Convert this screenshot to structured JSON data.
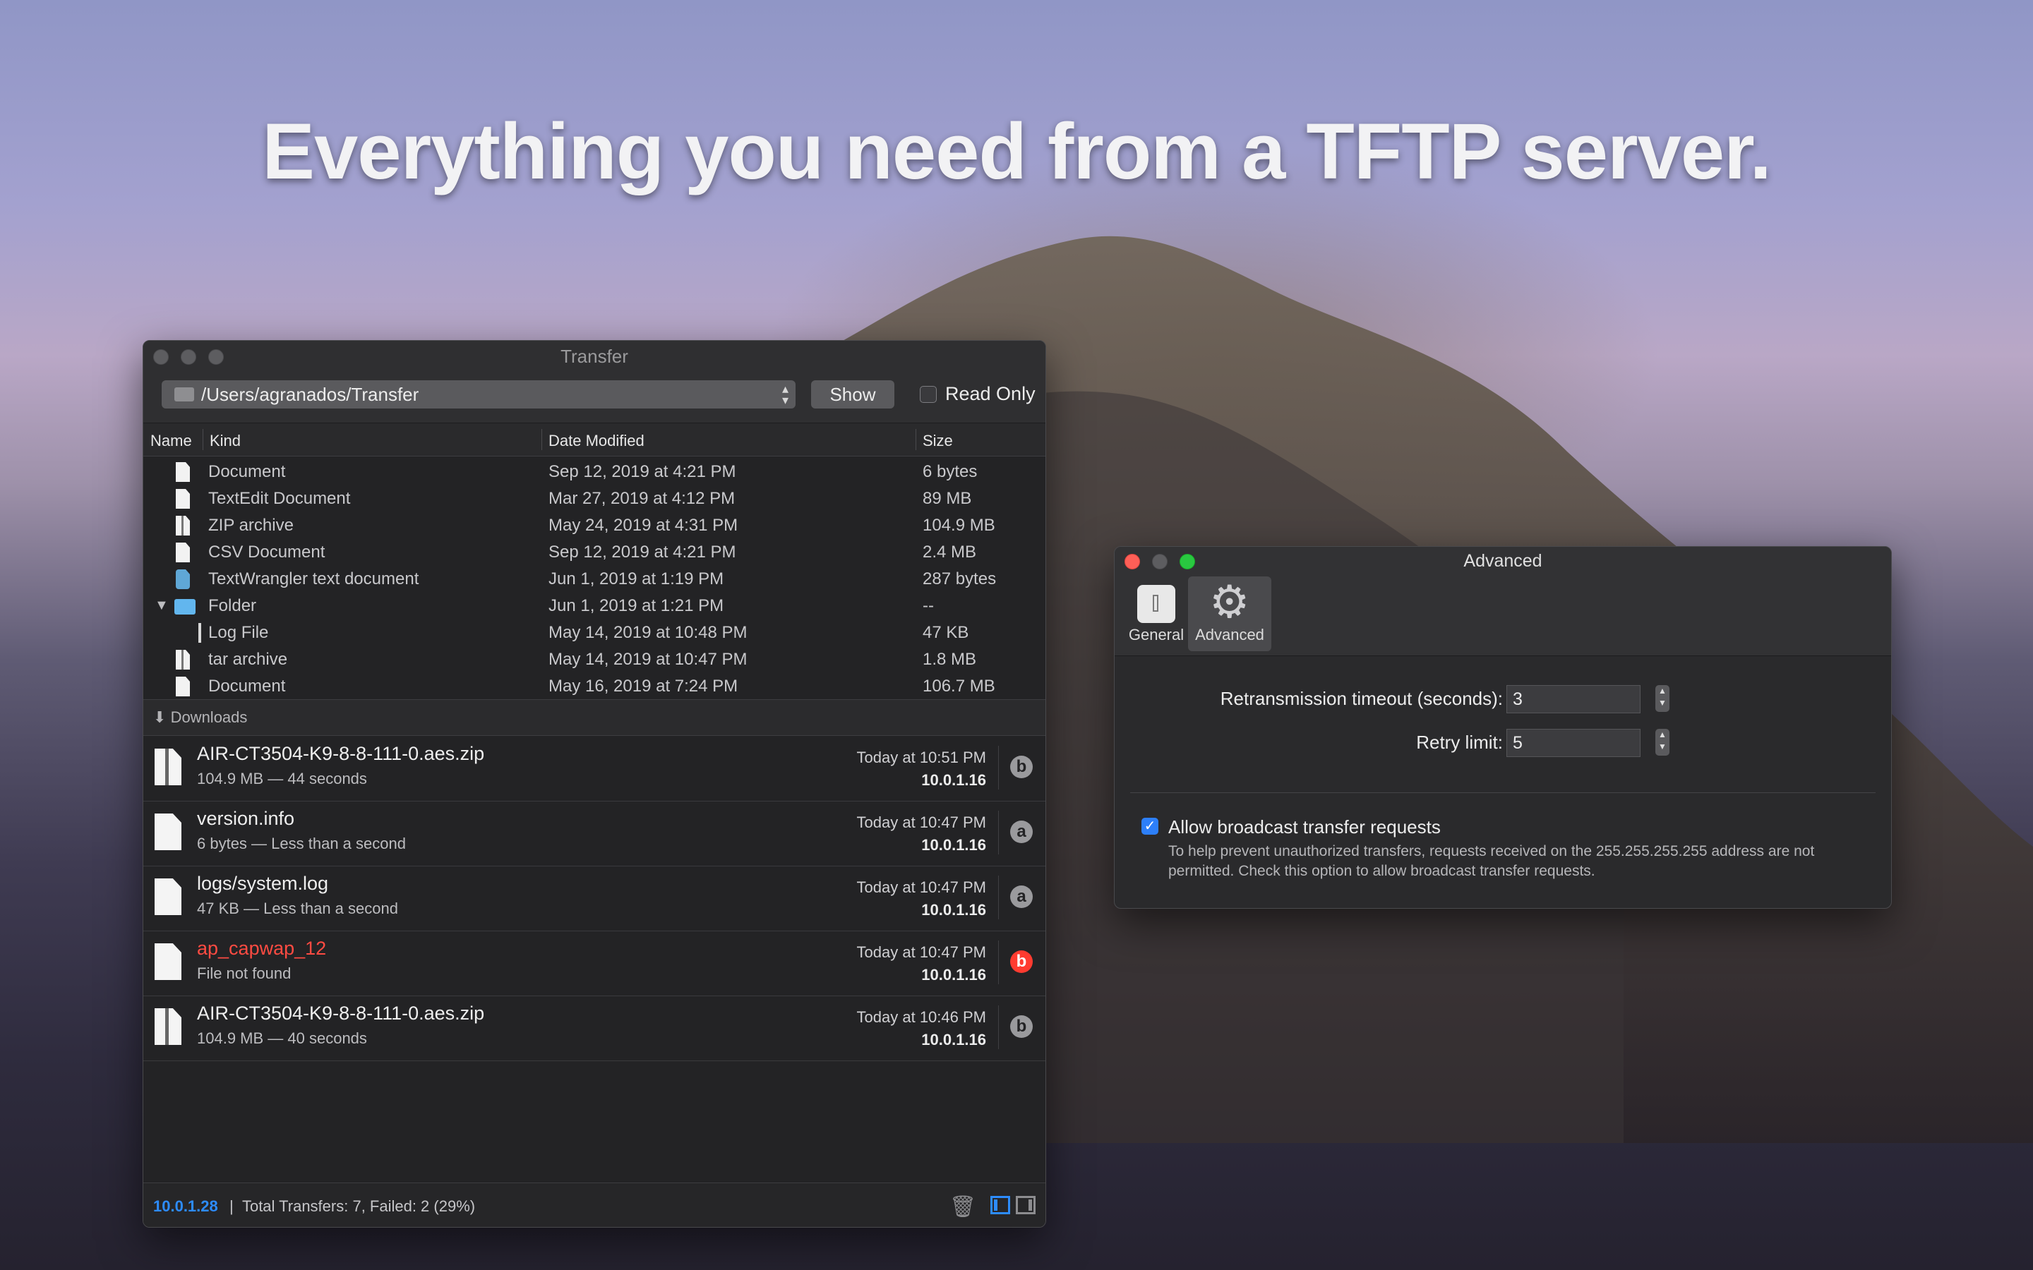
{
  "hero": {
    "headline": "Everything you need from a TFTP server."
  },
  "transfer_window": {
    "title": "Transfer",
    "path": "/Users/agranados/Transfer",
    "show_label": "Show",
    "read_only_label": "Read Only",
    "columns": {
      "name": "Name",
      "kind": "Kind",
      "date": "Date Modified",
      "size": "Size"
    },
    "files": [
      {
        "kind": "Document",
        "date": "Sep 12, 2019 at 4:21 PM",
        "size": "6 bytes",
        "icon": "document-icon"
      },
      {
        "kind": "TextEdit Document",
        "date": "Mar 27, 2019 at 4:12 PM",
        "size": "89 MB",
        "icon": "document-icon"
      },
      {
        "kind": "ZIP archive",
        "date": "May 24, 2019 at 4:31 PM",
        "size": "104.9 MB",
        "icon": "zip-file-icon"
      },
      {
        "kind": "CSV Document",
        "date": "Sep 12, 2019 at 4:21 PM",
        "size": "2.4 MB",
        "icon": "document-icon"
      },
      {
        "kind": "TextWrangler text document",
        "date": "Jun 1, 2019 at 1:19 PM",
        "size": "287 bytes",
        "icon": "textwrangler-icon"
      },
      {
        "kind": "Folder",
        "date": "Jun 1, 2019 at 1:21 PM",
        "size": "--",
        "icon": "folder-icon"
      },
      {
        "kind": "Log File",
        "date": "May 14, 2019 at 10:48 PM",
        "size": "47 KB",
        "icon": "log-file-icon"
      },
      {
        "kind": "tar archive",
        "date": "May 14, 2019 at 10:47 PM",
        "size": "1.8 MB",
        "icon": "zip-file-icon"
      },
      {
        "kind": "Document",
        "date": "May 16, 2019 at 7:24 PM",
        "size": "106.7 MB",
        "icon": "document-icon"
      }
    ],
    "downloads_label": "Downloads",
    "downloads": [
      {
        "name": "AIR-CT3504-K9-8-8-111-0.aes.zip",
        "detail": "104.9 MB — 44 seconds",
        "time": "Today at 10:51 PM",
        "ip": "10.0.1.16",
        "badge": "b",
        "error": false
      },
      {
        "name": "version.info",
        "detail": "6 bytes — Less than a second",
        "time": "Today at 10:47 PM",
        "ip": "10.0.1.16",
        "badge": "a",
        "error": false
      },
      {
        "name": "logs/system.log",
        "detail": "47 KB — Less than a second",
        "time": "Today at 10:47 PM",
        "ip": "10.0.1.16",
        "badge": "a",
        "error": false
      },
      {
        "name": "ap_capwap_12",
        "detail": "File not found",
        "time": "Today at 10:47 PM",
        "ip": "10.0.1.16",
        "badge": "b",
        "error": true
      },
      {
        "name": "AIR-CT3504-K9-8-8-111-0.aes.zip",
        "detail": "104.9 MB — 40 seconds",
        "time": "Today at 10:46 PM",
        "ip": "10.0.1.16",
        "badge": "b",
        "error": false
      }
    ],
    "status": {
      "ip": "10.0.1.28",
      "separator": "|",
      "summary": "Total Transfers: 7, Failed: 2 (29%)"
    }
  },
  "advanced_window": {
    "title": "Advanced",
    "tabs": {
      "general": "General",
      "advanced": "Advanced"
    },
    "retransmission_label": "Retransmission timeout (seconds):",
    "retransmission_value": "3",
    "retry_label": "Retry limit:",
    "retry_value": "5",
    "broadcast_label": "Allow broadcast transfer requests",
    "broadcast_help": "To help prevent unauthorized transfers, requests received on the 255.255.255.255 address are not permitted. Check this option to allow broadcast transfer requests."
  },
  "colors": {
    "accent": "#2d8cff",
    "error": "#ff3b30"
  }
}
